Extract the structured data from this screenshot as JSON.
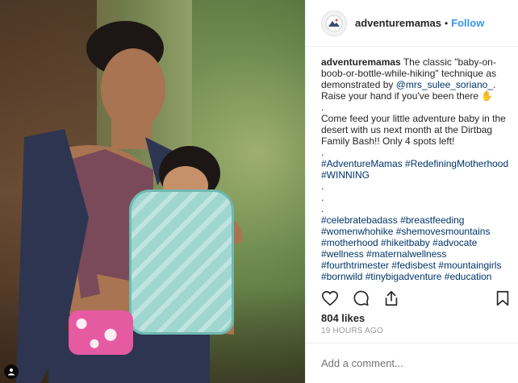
{
  "header": {
    "username": "adventuremamas",
    "separator": "•",
    "follow_label": "Follow"
  },
  "caption": {
    "author": "adventuremamas",
    "line1_text": " The classic \"baby-on-boob-or-bottle-while-hiking\" technique as demonstrated by ",
    "mention": "@mrs_sulee_soriano_",
    "line1_end": ".",
    "line2": "Raise your hand if you've been there ✋",
    "dot1": ".",
    "line3": "Come feed your little adventure baby in the desert with us next month at the Dirtbag Family Bash!! Only 4 spots left!",
    "dot2": ".",
    "hashtags1": "#AdventureMamas #RedefiningMotherhood #WINNING",
    "dot3": ".",
    "dot4": ".",
    "dot5": ".",
    "hashtags2": "#celebratebadass #breastfeeding #womenwhohike #shemovesmountains #motherhood #hikeitbaby #advocate #wellness #maternalwellness #fourthtrimester #fedisbest #mountaingirls #bornwild #tinybigadventure #education"
  },
  "actions": {
    "like_icon": "heart-icon",
    "comment_icon": "comment-icon",
    "share_icon": "share-icon",
    "save_icon": "bookmark-icon"
  },
  "likes": "804 likes",
  "timestamp": "19 HOURS AGO",
  "comment": {
    "placeholder": "Add a comment..."
  },
  "colors": {
    "follow": "#3897f0",
    "link": "#003569",
    "muted": "#999999"
  }
}
